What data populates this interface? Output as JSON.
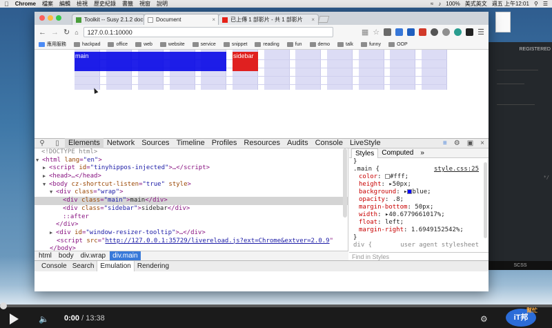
{
  "menubar": {
    "app": "Chrome",
    "items": [
      "檔案",
      "編輯",
      "檢視",
      "歷史紀錄",
      "書籤",
      "視窗",
      "說明"
    ],
    "battery": "100%",
    "input_method": "美式英文",
    "clock": "週五 上午12:01"
  },
  "tabs": [
    {
      "title": "Toolkit -- Susy 2.1.2 docu",
      "icon_color": "#4a9d3a"
    },
    {
      "title": "Document",
      "icon_color": "#777777"
    },
    {
      "title": "已上傳 1 部影片 - 共 1 部影片",
      "icon_color": "#e62117"
    }
  ],
  "toolbar": {
    "url": "127.0.0.1:10000",
    "back_icon": "arrow-left-icon",
    "forward_icon": "arrow-right-icon",
    "reload_icon": "reload-icon"
  },
  "bookmarks": {
    "apps_label": "應用服務",
    "items": [
      "hackpad",
      "office",
      "web",
      "website",
      "service",
      "snippet",
      "reading",
      "fun",
      "demo",
      "talk",
      "funny",
      "OOP"
    ]
  },
  "page": {
    "main_label": "main",
    "sidebar_label": "sidebar",
    "colors": {
      "main": "#0000e6",
      "sidebar": "#e02020",
      "grid": "#dcdcf5"
    }
  },
  "devtools": {
    "tabs": [
      "Elements",
      "Network",
      "Sources",
      "Timeline",
      "Profiles",
      "Resources",
      "Audits",
      "Console",
      "LiveStyle"
    ],
    "active_tab": "Elements",
    "dom": {
      "doctype": "<!DOCTYPE html>",
      "html_open": "html",
      "html_attr": "lang",
      "html_attr_val": "\"en\"",
      "script1_attr": "id",
      "script1_val": "\"tinyhippos-injected\"",
      "head": "<head>…</head>",
      "body_attr1": "cz-shortcut-listen",
      "body_attr1_val": "\"true\"",
      "body_attr2": "style",
      "wrap_class": "\"wrap\"",
      "main_class": "\"main\"",
      "main_text": "main",
      "sidebar_class": "\"sidebar\"",
      "sidebar_text": "sidebar",
      "after": "::after",
      "tooltip_id": "\"window-resizer-tooltip\"",
      "script2_src": "http://127.0.0.1:35729/livereload.js?ext=Chrome&extver=2.0.9"
    },
    "breadcrumbs": [
      "html",
      "body",
      "div.wrap",
      "div.main"
    ],
    "styles_tabs": [
      "Styles",
      "Computed"
    ],
    "rule": {
      "selector": ".main {",
      "source": "style.css:25",
      "props": [
        {
          "name": "color",
          "value": "#fff;"
        },
        {
          "name": "height",
          "value": "50px;"
        },
        {
          "name": "background",
          "value": "blue;"
        },
        {
          "name": "opacity",
          "value": ".8;"
        },
        {
          "name": "margin-bottom",
          "value": "50px;"
        },
        {
          "name": "width",
          "value": "40.6779661017%;"
        },
        {
          "name": "float",
          "value": "left;"
        },
        {
          "name": "margin-right",
          "value": "1.6949152542%;"
        }
      ],
      "close": "}",
      "next_selector": "div {",
      "next_source": "user agent stylesheet"
    },
    "filter_placeholder": "Find in Styles",
    "drawer_tabs": [
      "Console",
      "Search",
      "Emulation",
      "Rendering"
    ],
    "drawer_active": "Emulation"
  },
  "editor": {
    "registered": "REGISTERED",
    "snippet": "*/",
    "status": "SCSS"
  },
  "player": {
    "current": "0:00",
    "separator": " / ",
    "total": "13:38",
    "logo_text": "iT邦",
    "logo_sub": "幫忙",
    "progress": 0
  }
}
